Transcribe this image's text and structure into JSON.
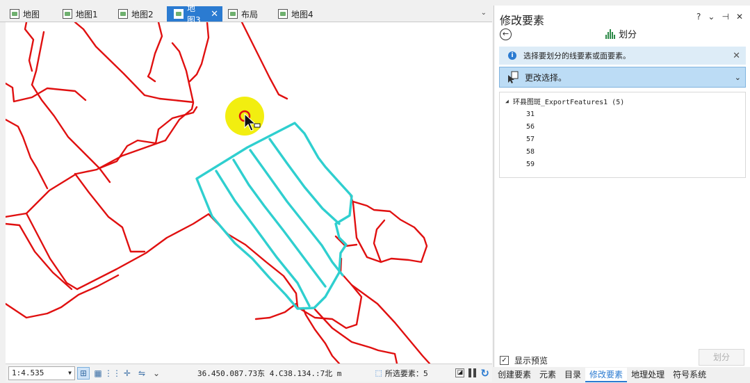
{
  "map_tabs": [
    {
      "label": "地图",
      "icon": "map-icon"
    },
    {
      "label": "地图1",
      "icon": "map-icon"
    },
    {
      "label": "地图2",
      "icon": "map-icon"
    },
    {
      "label": "地图3",
      "icon": "map-icon",
      "active": true
    },
    {
      "label": "布局",
      "icon": "layout-icon"
    },
    {
      "label": "地图4",
      "icon": "map-icon"
    }
  ],
  "colors": {
    "parcel_outline": "#e01010",
    "selected_outline": "#2fcfcf",
    "cursor_highlight": "#f2ee10",
    "accent": "#2b7bd1"
  },
  "status": {
    "scale": "1:4.535",
    "coordinates": "36.450.087.73东 4.C38.134.:7北 m",
    "selected_label": "所选要素：5"
  },
  "pane": {
    "title": "修改要素",
    "controls": [
      "?",
      "⌄",
      "⊣",
      "✕"
    ],
    "tool_title": "划分",
    "info_message": "选择要划分的线要素或面要素。",
    "select_label": "更改选择。",
    "tree_root": "环县图斑_ExportFeatures1 (5)",
    "tree_items": [
      "31",
      "56",
      "57",
      "58",
      "59"
    ],
    "preview_label": "显示预览",
    "preview_checked": true,
    "split_button": "划分"
  },
  "pane_tabs": [
    {
      "label": "创建要素"
    },
    {
      "label": "元素"
    },
    {
      "label": "目录"
    },
    {
      "label": "修改要素",
      "active": true
    },
    {
      "label": "地理处理"
    },
    {
      "label": "符号系统"
    }
  ]
}
